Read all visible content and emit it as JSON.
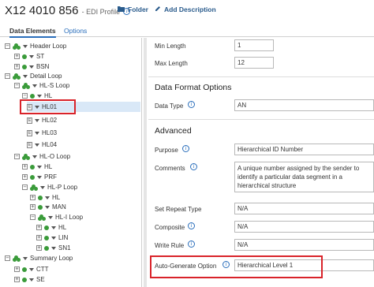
{
  "header": {
    "title": "X12 4010 856",
    "subtitle": "- EDI Profile",
    "folder_label": "Folder",
    "add_description_label": "Add Description"
  },
  "tabs": [
    {
      "label": "Data Elements",
      "active": true
    },
    {
      "label": "Options",
      "active": false
    }
  ],
  "tree": {
    "items": [
      {
        "label": "Header Loop",
        "kind": "loop"
      },
      {
        "label": "ST",
        "kind": "segment"
      },
      {
        "label": "BSN",
        "kind": "segment"
      },
      {
        "label": "Detail Loop",
        "kind": "loop"
      },
      {
        "label": "HL-S Loop",
        "kind": "loop"
      },
      {
        "label": "HL",
        "kind": "segment"
      },
      {
        "label": "HL01",
        "kind": "element",
        "selected": true
      },
      {
        "label": "HL02",
        "kind": "element"
      },
      {
        "label": "HL03",
        "kind": "element"
      },
      {
        "label": "HL04",
        "kind": "element"
      },
      {
        "label": "HL-O Loop",
        "kind": "loop"
      },
      {
        "label": "HL",
        "kind": "segment"
      },
      {
        "label": "PRF",
        "kind": "segment"
      },
      {
        "label": "HL-P Loop",
        "kind": "loop"
      },
      {
        "label": "HL",
        "kind": "segment"
      },
      {
        "label": "MAN",
        "kind": "segment"
      },
      {
        "label": "HL-I Loop",
        "kind": "loop"
      },
      {
        "label": "HL",
        "kind": "segment"
      },
      {
        "label": "LIN",
        "kind": "segment"
      },
      {
        "label": "SN1",
        "kind": "segment"
      },
      {
        "label": "Summary Loop",
        "kind": "loop"
      },
      {
        "label": "CTT",
        "kind": "segment"
      },
      {
        "label": "SE",
        "kind": "segment"
      }
    ]
  },
  "properties": {
    "min_length_label": "Min Length",
    "min_length_value": "1",
    "max_length_label": "Max Length",
    "max_length_value": "12",
    "data_format_heading": "Data Format Options",
    "data_type_label": "Data Type",
    "data_type_value": "AN",
    "advanced_heading": "Advanced",
    "purpose_label": "Purpose",
    "purpose_value": "Hierarchical ID Number",
    "comments_label": "Comments",
    "comments_value": "A unique number assigned by the sender to identify a particular data segment in a hierarchical structure",
    "set_repeat_type_label": "Set Repeat Type",
    "set_repeat_type_value": "N/A",
    "composite_label": "Composite",
    "composite_value": "N/A",
    "write_rule_label": "Write Rule",
    "write_rule_value": "N/A",
    "auto_generate_label": "Auto-Generate Option",
    "auto_generate_value": "Hierarchical Level 1"
  },
  "colors": {
    "accent": "#2a6ebb",
    "highlight_box": "#d9232a",
    "selected_row": "#d9e8f7",
    "loop_icon": "#3a9b3a"
  }
}
